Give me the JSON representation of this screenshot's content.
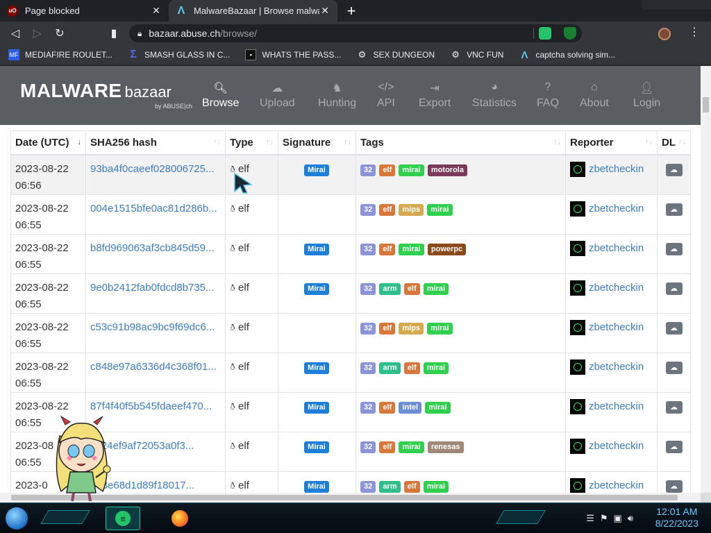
{
  "browser": {
    "tabs": [
      {
        "title": "Page blocked",
        "icon": "ublock-icon",
        "active": false
      },
      {
        "title": "MalwareBazaar | Browse malware s",
        "icon": "malwarebazaar-icon",
        "active": true
      }
    ],
    "url_host": "bazaar.abuse.ch",
    "url_path": "/browse/",
    "bookmarks": [
      {
        "label": "MEDIAFIRE ROULET...",
        "icon": "mediafire-icon"
      },
      {
        "label": "SMASH GLASS IN C...",
        "icon": "sigma-icon"
      },
      {
        "label": "WHATS THE PASS...",
        "icon": "password-icon"
      },
      {
        "label": "SEX DUNGEON",
        "icon": "gear-icon"
      },
      {
        "label": "VNC FUN",
        "icon": "gear-icon"
      },
      {
        "label": "captcha solving sim...",
        "icon": "captcha-icon"
      }
    ]
  },
  "site": {
    "logo_main": "MALWARE",
    "logo_sub": "bazaar",
    "logo_by": "by ABUSE|ch",
    "nav": [
      {
        "label": "Browse",
        "icon": "search-icon",
        "active": true
      },
      {
        "label": "Upload",
        "icon": "upload-icon",
        "active": false
      },
      {
        "label": "Hunting",
        "icon": "hunting-icon",
        "active": false
      },
      {
        "label": "API",
        "icon": "code-icon",
        "active": false
      },
      {
        "label": "Export",
        "icon": "export-icon",
        "active": false
      },
      {
        "label": "Statistics",
        "icon": "pie-chart-icon",
        "active": false
      },
      {
        "label": "FAQ",
        "icon": "question-icon",
        "active": false
      },
      {
        "label": "About",
        "icon": "building-icon",
        "active": false
      },
      {
        "label": "Login",
        "icon": "user-icon",
        "active": false
      }
    ]
  },
  "table": {
    "headers": [
      "Date (UTC)",
      "SHA256 hash",
      "Type",
      "Signature",
      "Tags",
      "Reporter",
      "DL"
    ],
    "rows": [
      {
        "date": "2023-08-22",
        "time": "06:56",
        "hash": "93ba4f0caeef028006725...",
        "type": "elf",
        "signature": "Mirai",
        "tags": [
          "32",
          "elf",
          "mirai",
          "motorola"
        ],
        "reporter": "zbetcheckin"
      },
      {
        "date": "2023-08-22",
        "time": "06:55",
        "hash": "004e1515bfe0ac81d286b...",
        "type": "elf",
        "signature": "",
        "tags": [
          "32",
          "elf",
          "mips",
          "mirai"
        ],
        "reporter": "zbetcheckin"
      },
      {
        "date": "2023-08-22",
        "time": "06:55",
        "hash": "b8fd969063af3cb845d59...",
        "type": "elf",
        "signature": "Mirai",
        "tags": [
          "32",
          "elf",
          "mirai",
          "powerpc"
        ],
        "reporter": "zbetcheckin"
      },
      {
        "date": "2023-08-22",
        "time": "06:55",
        "hash": "9e0b2412fab0fdcd8b735...",
        "type": "elf",
        "signature": "Mirai",
        "tags": [
          "32",
          "arm",
          "elf",
          "mirai"
        ],
        "reporter": "zbetcheckin"
      },
      {
        "date": "2023-08-22",
        "time": "06:55",
        "hash": "c53c91b98ac9bc9f69dc6...",
        "type": "elf",
        "signature": "",
        "tags": [
          "32",
          "elf",
          "mips",
          "mirai"
        ],
        "reporter": "zbetcheckin"
      },
      {
        "date": "2023-08-22",
        "time": "06:55",
        "hash": "c848e97a6336d4c368f01...",
        "type": "elf",
        "signature": "Mirai",
        "tags": [
          "32",
          "arm",
          "elf",
          "mirai"
        ],
        "reporter": "zbetcheckin"
      },
      {
        "date": "2023-08-22",
        "time": "06:55",
        "hash": "87f4f40f5b545fdaeef470...",
        "type": "elf",
        "signature": "Mirai",
        "tags": [
          "32",
          "elf",
          "intel",
          "mirai"
        ],
        "reporter": "zbetcheckin"
      },
      {
        "date": "2023-08",
        "time": "06:55",
        "hash": "1c24ef9af72053a0f3...",
        "type": "elf",
        "signature": "Mirai",
        "tags": [
          "32",
          "elf",
          "mirai",
          "renesas"
        ],
        "reporter": "zbetcheckin"
      },
      {
        "date": "2023-0",
        "time": "",
        "hash": "bd3e68d1d89f18017...",
        "type": "elf",
        "signature": "Mirai",
        "tags": [
          "32",
          "arm",
          "elf",
          "mirai"
        ],
        "reporter": "zbetcheckin"
      }
    ]
  },
  "tag_colors": {
    "32": "#8a94d6",
    "elf": "#d9773a",
    "mirai": "#2fd04d",
    "mips": "#d4a94f",
    "arm": "#2ebf8a",
    "intel": "#6b8fd6",
    "motorola": "#7a3a5a",
    "powerpc": "#8a4a1a",
    "renesas": "#a08878",
    "Mirai": "#1e7fdb"
  },
  "taskbar": {
    "time": "12:01 AM",
    "date": "8/22/2023"
  }
}
